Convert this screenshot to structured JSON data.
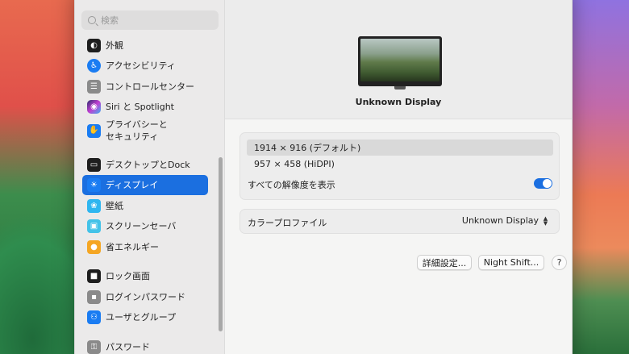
{
  "search": {
    "placeholder": "検索"
  },
  "sidebar": {
    "items": [
      {
        "label": "外観",
        "icon": "appearance-icon",
        "color": "#1e1e1e"
      },
      {
        "label": "アクセシビリティ",
        "icon": "accessibility-icon",
        "color": "#1a7cf2"
      },
      {
        "label": "コントロールセンター",
        "icon": "control-center-icon",
        "color": "#8a8a8a"
      },
      {
        "label": "Siri と Spotlight",
        "icon": "siri-icon",
        "color": "#7e3fd1"
      },
      {
        "label": "プライバシーと\nセキュリティ",
        "icon": "hand-icon",
        "color": "#1a7cf2"
      },
      {
        "label": "デスクトップとDock",
        "icon": "dock-icon",
        "color": "#1e1e1e"
      },
      {
        "label": "ディスプレイ",
        "icon": "display-icon",
        "color": "#1a7cf2"
      },
      {
        "label": "壁紙",
        "icon": "wallpaper-icon",
        "color": "#2fb6f0"
      },
      {
        "label": "スクリーンセーバ",
        "icon": "screensaver-icon",
        "color": "#43c2e8"
      },
      {
        "label": "省エネルギー",
        "icon": "energy-icon",
        "color": "#f5a623"
      },
      {
        "label": "ロック画面",
        "icon": "lock-screen-icon",
        "color": "#1e1e1e"
      },
      {
        "label": "ログインパスワード",
        "icon": "lock-icon",
        "color": "#8a8a8a"
      },
      {
        "label": "ユーザとグループ",
        "icon": "users-icon",
        "color": "#1a7cf2"
      },
      {
        "label": "パスワード",
        "icon": "key-icon",
        "color": "#8a8a8a"
      }
    ],
    "active_index": 6
  },
  "display": {
    "name": "Unknown Display",
    "resolutions": [
      {
        "label": "1914 × 916 (デフォルト)",
        "selected": true
      },
      {
        "label": "957 × 458 (HiDPI)",
        "selected": false
      }
    ],
    "show_all_label": "すべての解像度を表示",
    "show_all_on": true,
    "color_profile_label": "カラープロファイル",
    "color_profile_value": "Unknown Display",
    "stepper_icon": "up-down-chevron-icon"
  },
  "buttons": {
    "advanced": "詳細設定...",
    "night_shift": "Night Shift...",
    "help": "?"
  }
}
